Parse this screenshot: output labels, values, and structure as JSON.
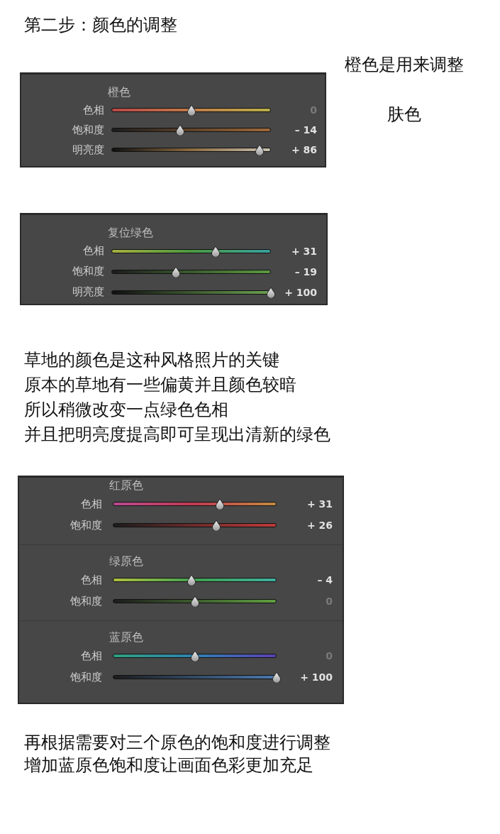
{
  "title": "第二步：颜色的调整",
  "blocks": [
    {
      "kind": "panel",
      "note": [
        "橙色是用来调整",
        "肤色"
      ],
      "groups": [
        {
          "title": "橙色",
          "sliders": [
            {
              "label": "色相",
              "level": 0.5,
              "value": "0",
              "dimmed": true
            },
            {
              "label": "饱和度",
              "level": 0.43,
              "value": "– 14",
              "dimmed": false
            },
            {
              "label": "明亮度",
              "level": 0.93,
              "value": "+ 86",
              "dimmed": false
            }
          ]
        }
      ]
    },
    {
      "kind": "panel",
      "groups": [
        {
          "title": "复位绿色",
          "sliders": [
            {
              "label": "色相",
              "level": 0.655,
              "value": "+ 31",
              "dimmed": false
            },
            {
              "label": "饱和度",
              "level": 0.405,
              "value": "– 19",
              "dimmed": false
            },
            {
              "label": "明亮度",
              "level": 1,
              "value": "+ 100",
              "dimmed": false
            }
          ]
        }
      ]
    },
    {
      "kind": "text",
      "lines": [
        "草地的颜色是这种风格照片的关键",
        "原本的草地有一些偏黄并且颜色较暗",
        "所以稍微改变一点绿色色相",
        "并且把明亮度提高即可呈现出清新的绿色"
      ]
    },
    {
      "kind": "panel",
      "groups": [
        {
          "title": "红原色",
          "sliders": [
            {
              "label": "色相",
              "level": 0.655,
              "value": "+ 31",
              "dimmed": false
            },
            {
              "label": "饱和度",
              "level": 0.63,
              "value": "+ 26",
              "dimmed": false
            }
          ]
        },
        {
          "title": "绿原色",
          "sliders": [
            {
              "label": "色相",
              "level": 0.48,
              "value": "– 4",
              "dimmed": false
            },
            {
              "label": "饱和度",
              "level": 0.5,
              "value": "0",
              "dimmed": true
            }
          ]
        },
        {
          "title": "蓝原色",
          "sliders": [
            {
              "label": "色相",
              "level": 0.5,
              "value": "0",
              "dimmed": true
            },
            {
              "label": "饱和度",
              "level": 1,
              "value": "+ 100",
              "dimmed": false
            }
          ]
        }
      ]
    },
    {
      "kind": "text",
      "lines": [
        "再根据需要对三个原色的饱和度进行调整",
        "增加蓝原色饱和度让画面色彩更加充足"
      ]
    }
  ]
}
